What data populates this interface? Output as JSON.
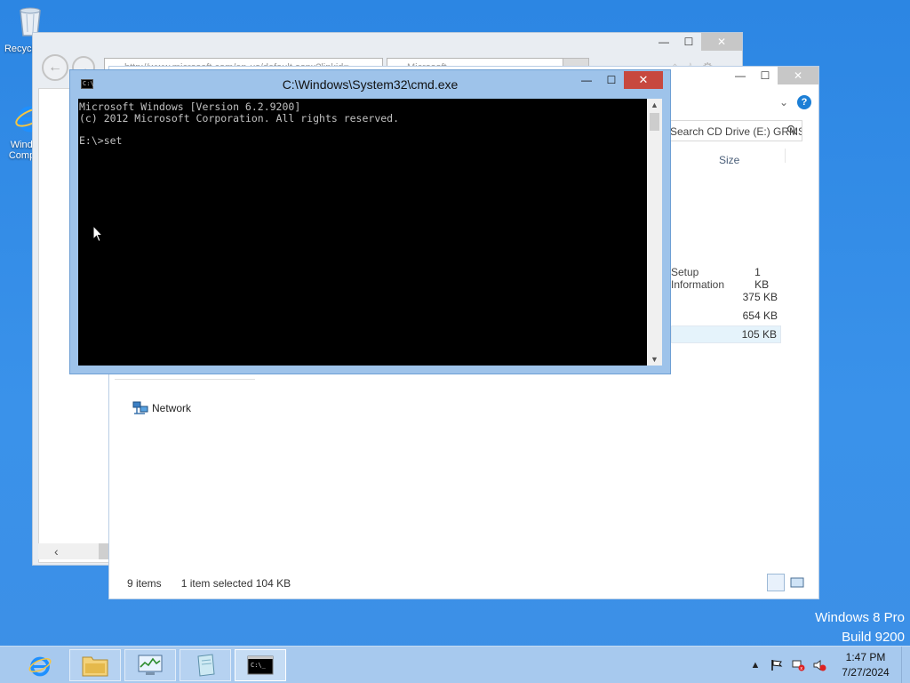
{
  "desktop": {
    "icons": [
      {
        "label": "Recycle Bin"
      },
      {
        "label": "Windows Computer"
      }
    ]
  },
  "ie_window": {
    "address_text": "http://www.microsoft.com/en-us/default.aspx?linkid=...",
    "tab_text": "Microsoft"
  },
  "explorer_window": {
    "search_text": "Search CD Drive (E:) GRMSXF...",
    "column_size": "Size",
    "rows": [
      {
        "name": "Setup Information",
        "size": "1 KB"
      },
      {
        "name": "",
        "size": "375 KB"
      },
      {
        "name": "",
        "size": "654 KB"
      },
      {
        "name": "",
        "size": "105 KB"
      }
    ],
    "nav_network": "Network",
    "status_items": "9 items",
    "status_selected": "1 item selected  104 KB"
  },
  "cmd_window": {
    "title": "C:\\Windows\\System32\\cmd.exe",
    "console_text": "Microsoft Windows [Version 6.2.9200]\n(c) 2012 Microsoft Corporation. All rights reserved.\n\nE:\\>set"
  },
  "watermark": {
    "line1": "Windows 8 Pro",
    "line2": "Build 9200"
  },
  "taskbar": {
    "apps": [
      "internet-explorer",
      "file-explorer",
      "task-manager",
      "notepad",
      "command-prompt"
    ],
    "clock_time": "1:47 PM",
    "clock_date": "7/27/2024"
  },
  "colors": {
    "desktop": "#2f8ae6",
    "cmd_frame": "#9ec3ea",
    "close_red": "#c7483f",
    "taskbar": "#a7c9ee"
  }
}
